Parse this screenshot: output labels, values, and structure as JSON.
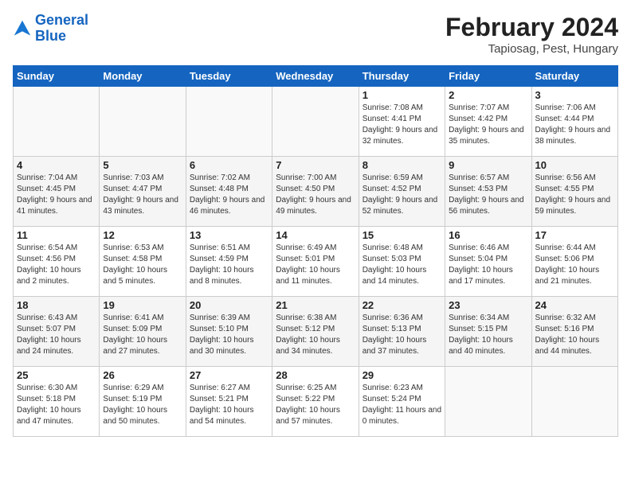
{
  "logo": {
    "line1": "General",
    "line2": "Blue"
  },
  "title": "February 2024",
  "location": "Tapiosag, Pest, Hungary",
  "days_header": [
    "Sunday",
    "Monday",
    "Tuesday",
    "Wednesday",
    "Thursday",
    "Friday",
    "Saturday"
  ],
  "weeks": [
    [
      {
        "num": "",
        "info": ""
      },
      {
        "num": "",
        "info": ""
      },
      {
        "num": "",
        "info": ""
      },
      {
        "num": "",
        "info": ""
      },
      {
        "num": "1",
        "info": "Sunrise: 7:08 AM\nSunset: 4:41 PM\nDaylight: 9 hours\nand 32 minutes."
      },
      {
        "num": "2",
        "info": "Sunrise: 7:07 AM\nSunset: 4:42 PM\nDaylight: 9 hours\nand 35 minutes."
      },
      {
        "num": "3",
        "info": "Sunrise: 7:06 AM\nSunset: 4:44 PM\nDaylight: 9 hours\nand 38 minutes."
      }
    ],
    [
      {
        "num": "4",
        "info": "Sunrise: 7:04 AM\nSunset: 4:45 PM\nDaylight: 9 hours\nand 41 minutes."
      },
      {
        "num": "5",
        "info": "Sunrise: 7:03 AM\nSunset: 4:47 PM\nDaylight: 9 hours\nand 43 minutes."
      },
      {
        "num": "6",
        "info": "Sunrise: 7:02 AM\nSunset: 4:48 PM\nDaylight: 9 hours\nand 46 minutes."
      },
      {
        "num": "7",
        "info": "Sunrise: 7:00 AM\nSunset: 4:50 PM\nDaylight: 9 hours\nand 49 minutes."
      },
      {
        "num": "8",
        "info": "Sunrise: 6:59 AM\nSunset: 4:52 PM\nDaylight: 9 hours\nand 52 minutes."
      },
      {
        "num": "9",
        "info": "Sunrise: 6:57 AM\nSunset: 4:53 PM\nDaylight: 9 hours\nand 56 minutes."
      },
      {
        "num": "10",
        "info": "Sunrise: 6:56 AM\nSunset: 4:55 PM\nDaylight: 9 hours\nand 59 minutes."
      }
    ],
    [
      {
        "num": "11",
        "info": "Sunrise: 6:54 AM\nSunset: 4:56 PM\nDaylight: 10 hours\nand 2 minutes."
      },
      {
        "num": "12",
        "info": "Sunrise: 6:53 AM\nSunset: 4:58 PM\nDaylight: 10 hours\nand 5 minutes."
      },
      {
        "num": "13",
        "info": "Sunrise: 6:51 AM\nSunset: 4:59 PM\nDaylight: 10 hours\nand 8 minutes."
      },
      {
        "num": "14",
        "info": "Sunrise: 6:49 AM\nSunset: 5:01 PM\nDaylight: 10 hours\nand 11 minutes."
      },
      {
        "num": "15",
        "info": "Sunrise: 6:48 AM\nSunset: 5:03 PM\nDaylight: 10 hours\nand 14 minutes."
      },
      {
        "num": "16",
        "info": "Sunrise: 6:46 AM\nSunset: 5:04 PM\nDaylight: 10 hours\nand 17 minutes."
      },
      {
        "num": "17",
        "info": "Sunrise: 6:44 AM\nSunset: 5:06 PM\nDaylight: 10 hours\nand 21 minutes."
      }
    ],
    [
      {
        "num": "18",
        "info": "Sunrise: 6:43 AM\nSunset: 5:07 PM\nDaylight: 10 hours\nand 24 minutes."
      },
      {
        "num": "19",
        "info": "Sunrise: 6:41 AM\nSunset: 5:09 PM\nDaylight: 10 hours\nand 27 minutes."
      },
      {
        "num": "20",
        "info": "Sunrise: 6:39 AM\nSunset: 5:10 PM\nDaylight: 10 hours\nand 30 minutes."
      },
      {
        "num": "21",
        "info": "Sunrise: 6:38 AM\nSunset: 5:12 PM\nDaylight: 10 hours\nand 34 minutes."
      },
      {
        "num": "22",
        "info": "Sunrise: 6:36 AM\nSunset: 5:13 PM\nDaylight: 10 hours\nand 37 minutes."
      },
      {
        "num": "23",
        "info": "Sunrise: 6:34 AM\nSunset: 5:15 PM\nDaylight: 10 hours\nand 40 minutes."
      },
      {
        "num": "24",
        "info": "Sunrise: 6:32 AM\nSunset: 5:16 PM\nDaylight: 10 hours\nand 44 minutes."
      }
    ],
    [
      {
        "num": "25",
        "info": "Sunrise: 6:30 AM\nSunset: 5:18 PM\nDaylight: 10 hours\nand 47 minutes."
      },
      {
        "num": "26",
        "info": "Sunrise: 6:29 AM\nSunset: 5:19 PM\nDaylight: 10 hours\nand 50 minutes."
      },
      {
        "num": "27",
        "info": "Sunrise: 6:27 AM\nSunset: 5:21 PM\nDaylight: 10 hours\nand 54 minutes."
      },
      {
        "num": "28",
        "info": "Sunrise: 6:25 AM\nSunset: 5:22 PM\nDaylight: 10 hours\nand 57 minutes."
      },
      {
        "num": "29",
        "info": "Sunrise: 6:23 AM\nSunset: 5:24 PM\nDaylight: 11 hours\nand 0 minutes."
      },
      {
        "num": "",
        "info": ""
      },
      {
        "num": "",
        "info": ""
      }
    ]
  ]
}
